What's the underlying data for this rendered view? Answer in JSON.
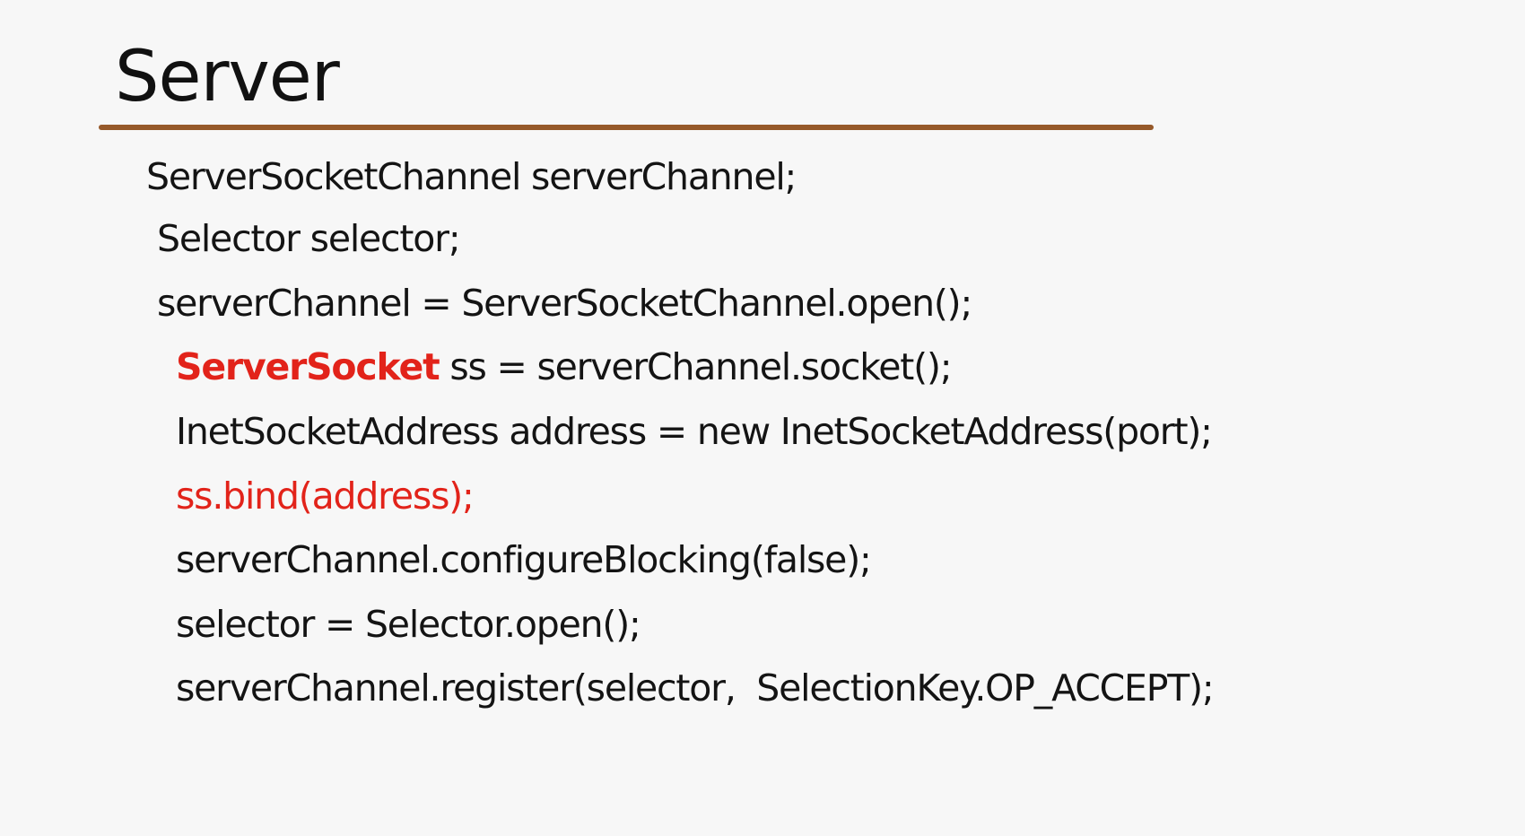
{
  "slide": {
    "title": "Server",
    "accent_color": "#96592a",
    "highlight_color": "#e2231a",
    "code_lines": [
      {
        "text": "ServerSocketChannel serverChannel;"
      },
      {
        "text": "Selector selector;"
      },
      {
        "text": "serverChannel = ServerSocketChannel.open();"
      },
      {
        "keyword": "ServerSocket",
        "rest": " ss = serverChannel.socket();"
      },
      {
        "text": "InetSocketAddress address = new InetSocketAddress(port);"
      },
      {
        "text": "ss.bind(address);"
      },
      {
        "text": "serverChannel.configureBlocking(false);"
      },
      {
        "text": "selector = Selector.open();"
      },
      {
        "text": "serverChannel.register(selector,  SelectionKey.OP_ACCEPT);"
      }
    ]
  }
}
